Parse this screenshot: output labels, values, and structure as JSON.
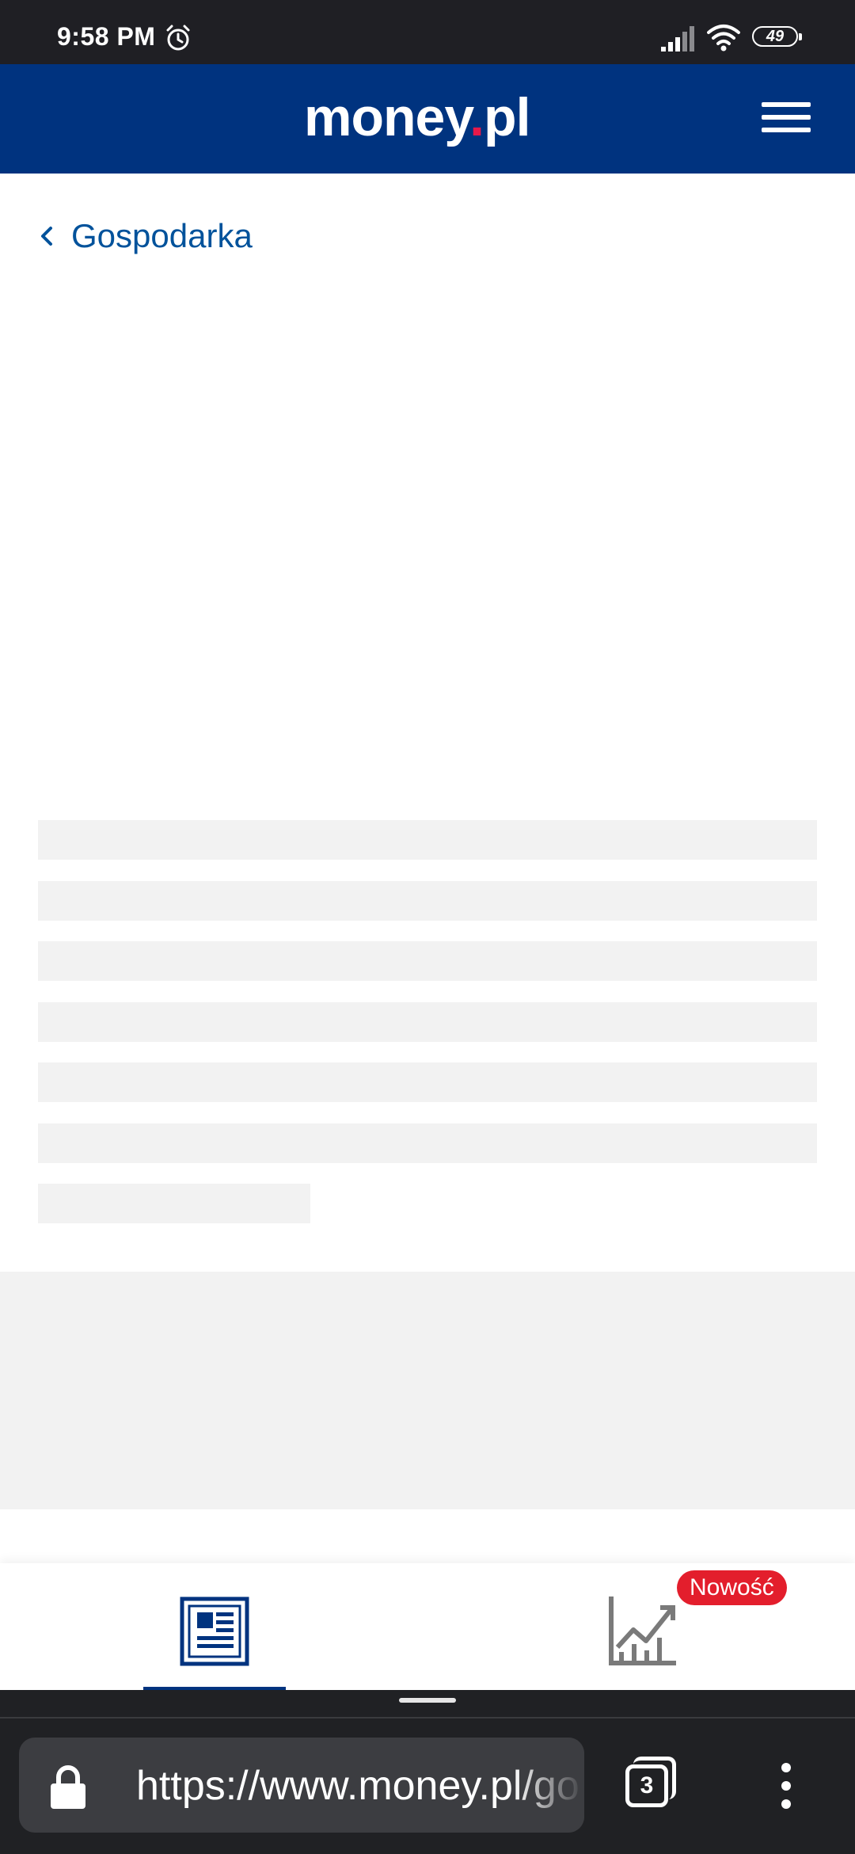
{
  "status_bar": {
    "time": "9:58 PM",
    "battery": "49",
    "icons": [
      "alarm-icon",
      "signal-icon",
      "wifi-icon",
      "battery-icon"
    ]
  },
  "header": {
    "logo_main": "money",
    "logo_dot": ".",
    "logo_tld": "pl",
    "menu_icon": "hamburger-menu-icon",
    "background_color": "#00337f",
    "logo_dot_color": "#e6194a"
  },
  "breadcrumb": {
    "label": "Gospodarka",
    "icon": "chevron-left-icon",
    "color": "#00529b"
  },
  "bottom_tabs": {
    "news_icon": "newspaper-icon",
    "markets_icon": "chart-growth-icon",
    "badge": "Nowość",
    "badge_color": "#e31e2c"
  },
  "browser": {
    "url": "https://www.money.pl/gospodarka",
    "tab_count": "3",
    "icons": [
      "lock-icon",
      "tab-switcher-icon",
      "more-vertical-icon"
    ]
  }
}
